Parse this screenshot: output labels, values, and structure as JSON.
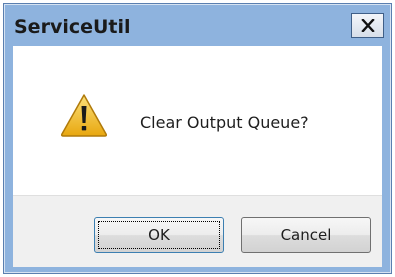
{
  "window": {
    "title": "ServiceUtil",
    "close_icon": "close-icon"
  },
  "message": {
    "icon": "warning-icon",
    "text": "Clear Output Queue?"
  },
  "buttons": {
    "ok_label": "OK",
    "cancel_label": "Cancel",
    "default": "OK"
  },
  "colors": {
    "title_bar": "#8eb3de",
    "warning_fill": "#f2c230",
    "button_area": "#f0f0f0"
  }
}
